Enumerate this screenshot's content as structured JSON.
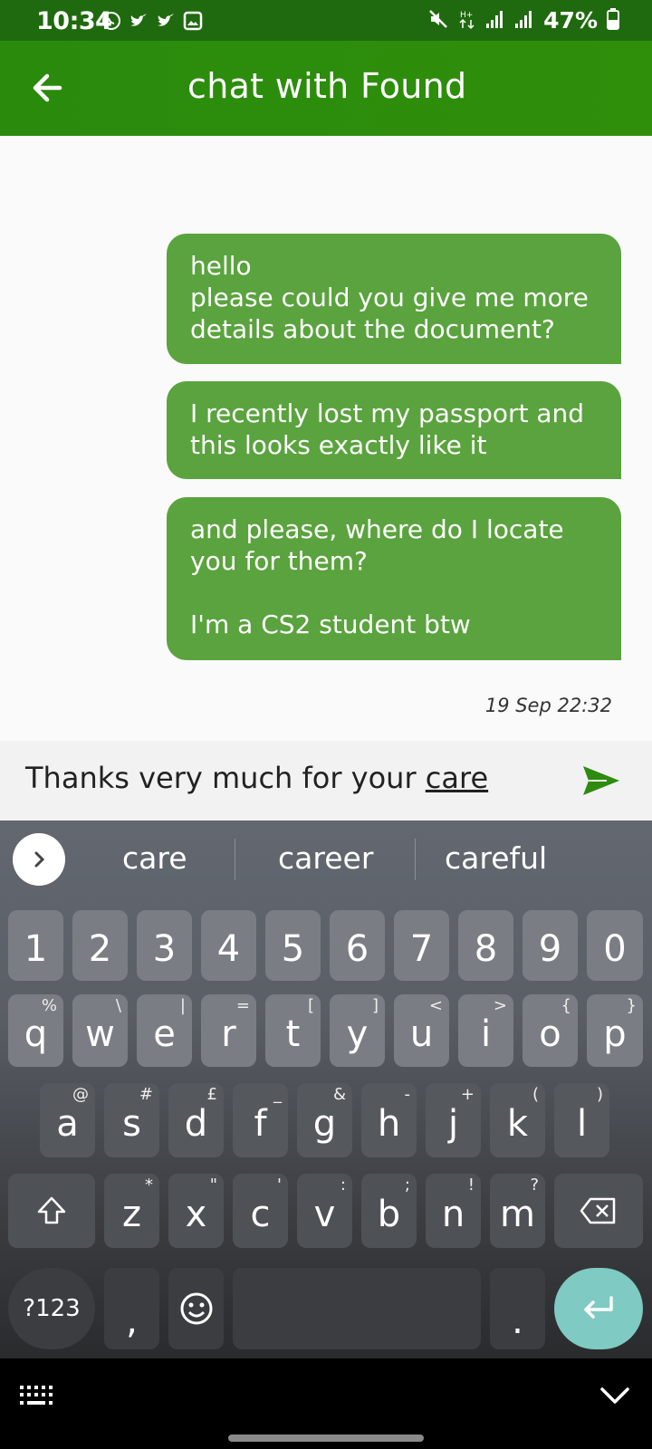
{
  "status_bar": {
    "time": "10:34",
    "battery": "47%"
  },
  "app_bar": {
    "title": "chat with Found"
  },
  "messages": [
    {
      "text": "hello\nplease could you give me more\ndetails about the document?"
    },
    {
      "text": "I recently lost my passport and\nthis looks exactly like it"
    },
    {
      "text": "and please, where do I locate\nyou for them?\n\nI'm a CS2 student btw"
    }
  ],
  "timestamp": "19 Sep 22:32",
  "input": {
    "value_prefix": "Thanks very much for your ",
    "value_underlined": "care"
  },
  "suggestions": [
    "care",
    "career",
    "careful"
  ],
  "keyboard": {
    "numbers": [
      "1",
      "2",
      "3",
      "4",
      "5",
      "6",
      "7",
      "8",
      "9",
      "0"
    ],
    "row1": [
      [
        "q",
        "%"
      ],
      [
        "w",
        "\\"
      ],
      [
        "e",
        "|"
      ],
      [
        "r",
        "="
      ],
      [
        "t",
        "["
      ],
      [
        "y",
        "]"
      ],
      [
        "u",
        "<"
      ],
      [
        "i",
        ">"
      ],
      [
        "o",
        "{"
      ],
      [
        "p",
        "}"
      ]
    ],
    "row2": [
      [
        "a",
        "@"
      ],
      [
        "s",
        "#"
      ],
      [
        "d",
        "£"
      ],
      [
        "f",
        "_"
      ],
      [
        "g",
        "&"
      ],
      [
        "h",
        "-"
      ],
      [
        "j",
        "+"
      ],
      [
        "k",
        "("
      ],
      [
        "l",
        ")"
      ]
    ],
    "row3": [
      [
        "z",
        "*"
      ],
      [
        "x",
        "\""
      ],
      [
        "c",
        "'"
      ],
      [
        "v",
        ":"
      ],
      [
        "b",
        ";"
      ],
      [
        "n",
        "!"
      ],
      [
        "m",
        "?"
      ]
    ],
    "symbols_label": "?123",
    "comma": ",",
    "period": "."
  },
  "colors": {
    "app_bar": "#2a8a0c",
    "bubble": "#5aa33e",
    "enter_key": "#7fcac3"
  }
}
